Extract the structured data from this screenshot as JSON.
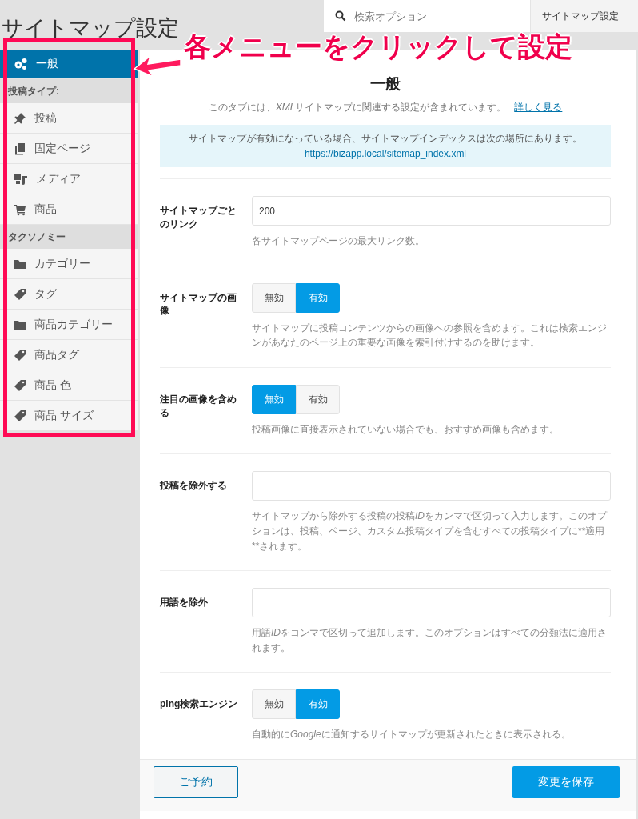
{
  "page_title": "サイトマップ設定",
  "search": {
    "placeholder": "検索オプション"
  },
  "top_tab": {
    "label": "サイトマップ設定"
  },
  "annotation": {
    "text": "各メニューをクリックして設定"
  },
  "sidebar": {
    "items": [
      {
        "kind": "item",
        "label": "一般",
        "selected": true
      },
      {
        "kind": "heading",
        "label": "投稿タイプ:"
      },
      {
        "kind": "item",
        "label": "投稿",
        "selected": false
      },
      {
        "kind": "item",
        "label": "固定ページ",
        "selected": false
      },
      {
        "kind": "item",
        "label": "メディア",
        "selected": false
      },
      {
        "kind": "item",
        "label": "商品",
        "selected": false
      },
      {
        "kind": "heading",
        "label": "タクソノミー"
      },
      {
        "kind": "item",
        "label": "カテゴリー",
        "selected": false
      },
      {
        "kind": "item",
        "label": "タグ",
        "selected": false
      },
      {
        "kind": "item",
        "label": "商品カテゴリー",
        "selected": false
      },
      {
        "kind": "item",
        "label": "商品タグ",
        "selected": false
      },
      {
        "kind": "item",
        "label": "商品 色",
        "selected": false
      },
      {
        "kind": "item",
        "label": "商品 サイズ",
        "selected": false
      }
    ]
  },
  "panel": {
    "title": "一般",
    "intro": [
      {
        "text": "このタブには、"
      },
      {
        "text": "XML",
        "italic": true
      },
      {
        "text": "サイトマップに関連する設定が含まれています。"
      }
    ],
    "intro_link": "詳しく見る",
    "notice": {
      "text": "サイトマップが有効になっている場合、サイトマップインデックスは次の場所にあります。",
      "link": "https://bizapp.local/sitemap_index.xml"
    },
    "settings": [
      {
        "kind": "input",
        "label": "サイトマップごとのリンク",
        "value": "200",
        "description": [
          {
            "text": "各サイトマップページの最大リンク数。"
          }
        ]
      },
      {
        "kind": "toggle",
        "label": "サイトマップの画像",
        "options": [
          {
            "label": "無効",
            "selected": false
          },
          {
            "label": "有効",
            "selected": true
          }
        ],
        "description": [
          {
            "text": "サイトマップに投稿コンテンツからの画像への参照を含めます。これは検索エンジンがあなたのページ上の重要な画像を索引付けするのを助けます。"
          }
        ]
      },
      {
        "kind": "toggle",
        "label": "注目の画像を含める",
        "options": [
          {
            "label": "無効",
            "selected": true
          },
          {
            "label": "有効",
            "selected": false
          }
        ],
        "description": [
          {
            "text": "投稿画像に直接表示されていない場合でも、おすすめ画像も含めます。"
          }
        ]
      },
      {
        "kind": "input",
        "label": "投稿を除外する",
        "description": [
          {
            "text": "サイトマップから除外する投稿の投稿"
          },
          {
            "text": "ID",
            "italic": true
          },
          {
            "text": "をカンマで区切って入力します。このオプションは、投稿、ページ、カスタム投稿タイプを含むすべての投稿タイプに**適用**されます。"
          }
        ]
      },
      {
        "kind": "input",
        "label": "用語を除外",
        "description": [
          {
            "text": "用語"
          },
          {
            "text": "ID",
            "italic": true
          },
          {
            "text": "をコンマで区切って追加します。このオプションはすべての分類法に適用されます。"
          }
        ]
      },
      {
        "kind": "toggle",
        "label": "ping検索エンジン",
        "options": [
          {
            "label": "無効",
            "selected": false
          },
          {
            "label": "有効",
            "selected": true
          }
        ],
        "description": [
          {
            "text": "自動的に"
          },
          {
            "text": "Google",
            "italic": true
          },
          {
            "text": "に通知するサイトマップが更新されたときに表示される。"
          }
        ]
      }
    ]
  },
  "footer": {
    "reset_button": "ご予約",
    "save_button": "変更を保存"
  }
}
